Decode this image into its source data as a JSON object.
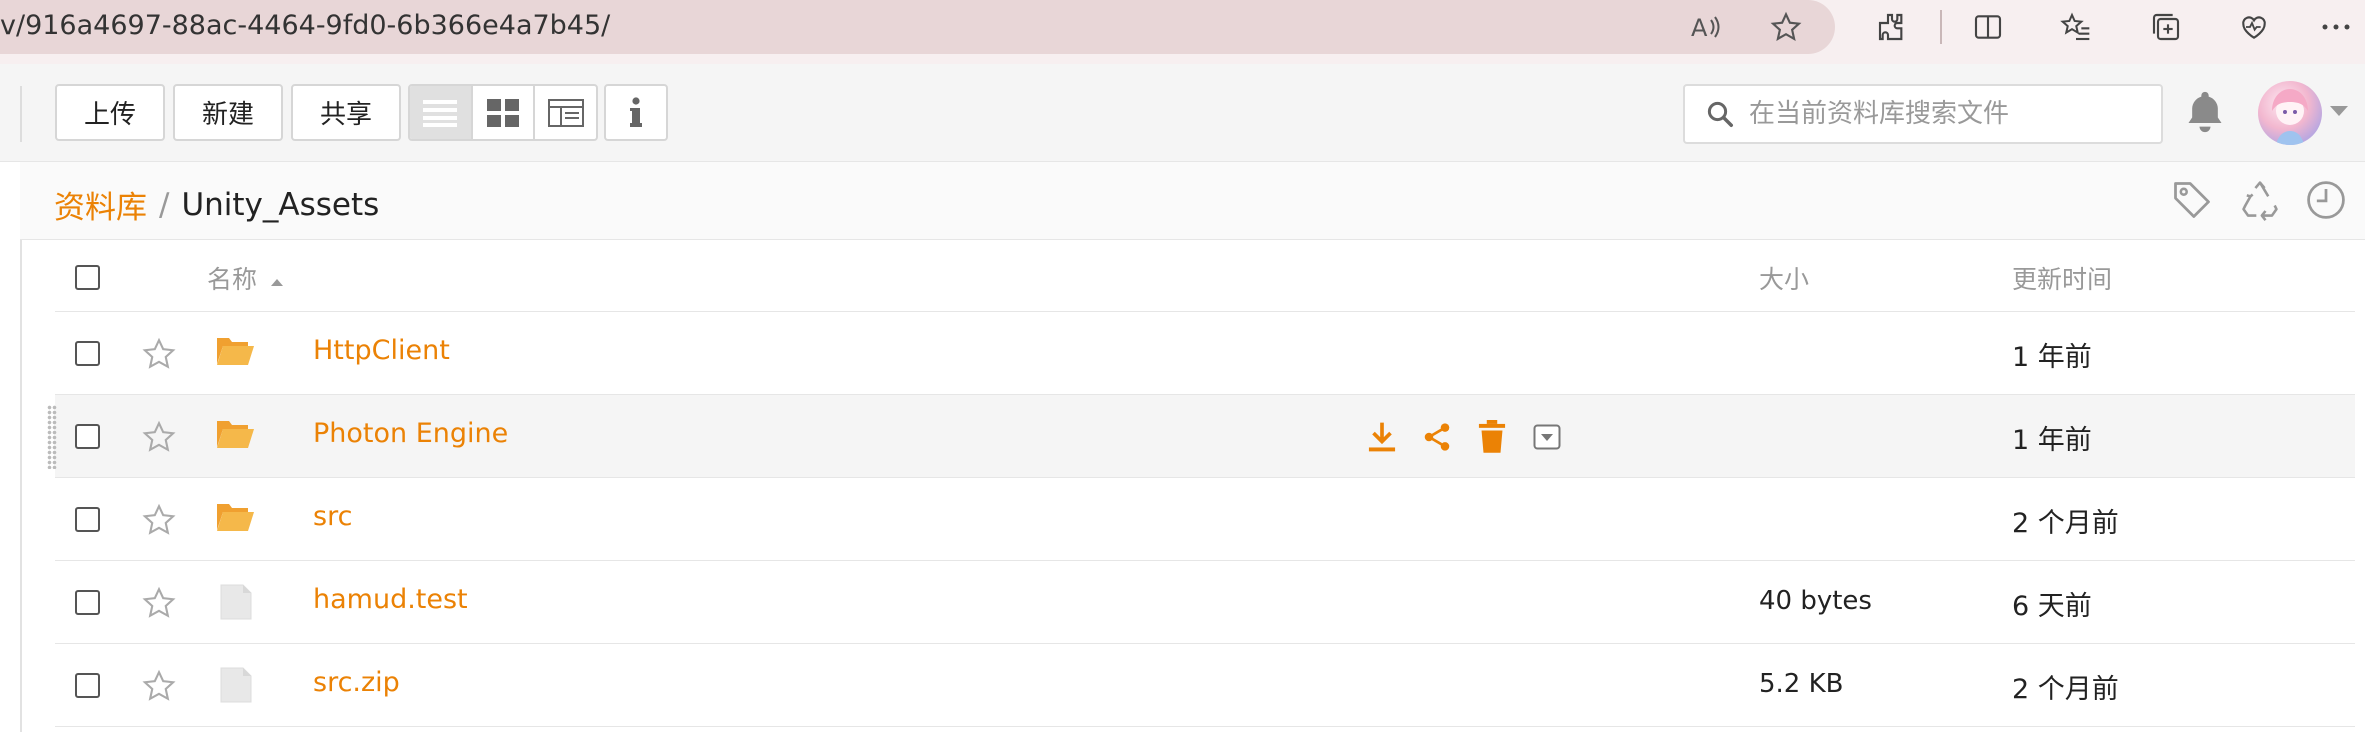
{
  "browser": {
    "url": "v/916a4697-88ac-4464-9fd0-6b366e4a7b45/"
  },
  "toolbar": {
    "upload_label": "上传",
    "new_label": "新建",
    "share_label": "共享",
    "search_placeholder": "在当前资料库搜索文件"
  },
  "breadcrumb": {
    "root": "资料库",
    "separator": "/",
    "current": "Unity_Assets"
  },
  "table": {
    "headers": {
      "name": "名称",
      "size": "大小",
      "updated": "更新时间"
    },
    "rows": [
      {
        "type": "folder",
        "name": "HttpClient",
        "size": "",
        "updated": "1 年前"
      },
      {
        "type": "folder",
        "name": "Photon Engine",
        "size": "",
        "updated": "1 年前"
      },
      {
        "type": "folder",
        "name": "src",
        "size": "",
        "updated": "2 个月前"
      },
      {
        "type": "file",
        "name": "hamud.test",
        "size": "40 bytes",
        "updated": "6 天前"
      },
      {
        "type": "file",
        "name": "src.zip",
        "size": "5.2 KB",
        "updated": "2 个月前"
      }
    ]
  },
  "colors": {
    "accent": "#eb8205",
    "addressbar": "#e8d6d7",
    "toolbar_bg": "#f5f5f5"
  }
}
